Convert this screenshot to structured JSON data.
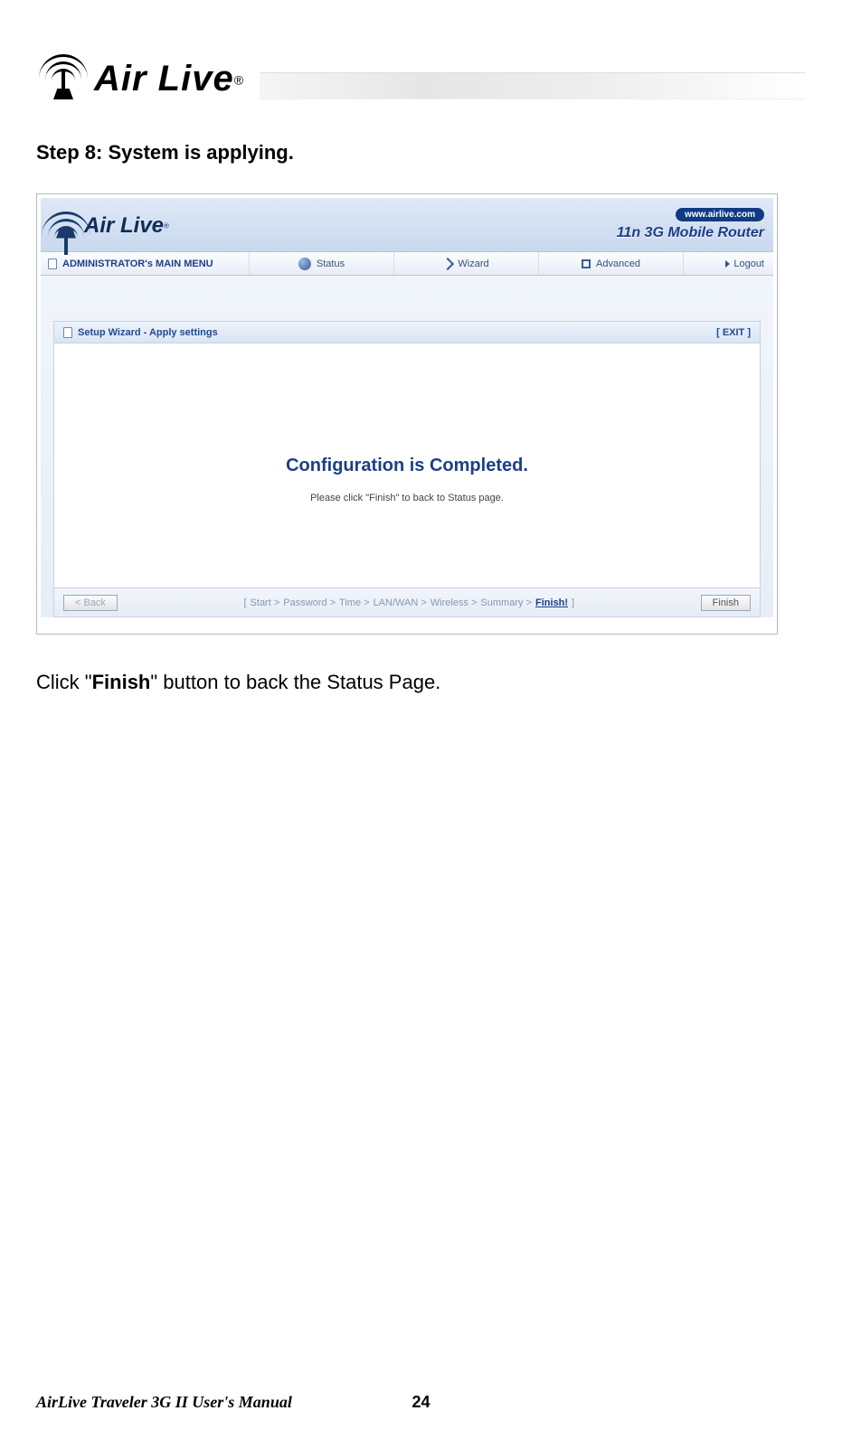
{
  "doc": {
    "brand": "Air Live",
    "step_title": "Step 8: System is applying.",
    "instruction_pre": "Click \"",
    "instruction_bold": "Finish",
    "instruction_post": "\" button to back the Status Page.",
    "footer_title": "AirLive Traveler 3G II User's Manual",
    "page_number": "24"
  },
  "router": {
    "brand": "Air Live",
    "url_pill": "www.airlive.com",
    "model": "11n 3G Mobile Router",
    "menu": {
      "main": "ADMINISTRATOR's MAIN MENU",
      "status": "Status",
      "wizard": "Wizard",
      "advanced": "Advanced",
      "logout": "Logout"
    },
    "panel": {
      "title": "Setup Wizard - Apply settings",
      "exit": "[ EXIT ]",
      "complete": "Configuration is Completed.",
      "hint": "Please click \"Finish\" to back to Status page.",
      "back_btn": "< Back",
      "finish_btn": "Finish",
      "crumbs": {
        "open": "[",
        "c1": "Start >",
        "c2": "Password >",
        "c3": "Time >",
        "c4": "LAN/WAN >",
        "c5": "Wireless >",
        "c6": "Summary >",
        "c7": "Finish!",
        "close": "]"
      }
    }
  }
}
